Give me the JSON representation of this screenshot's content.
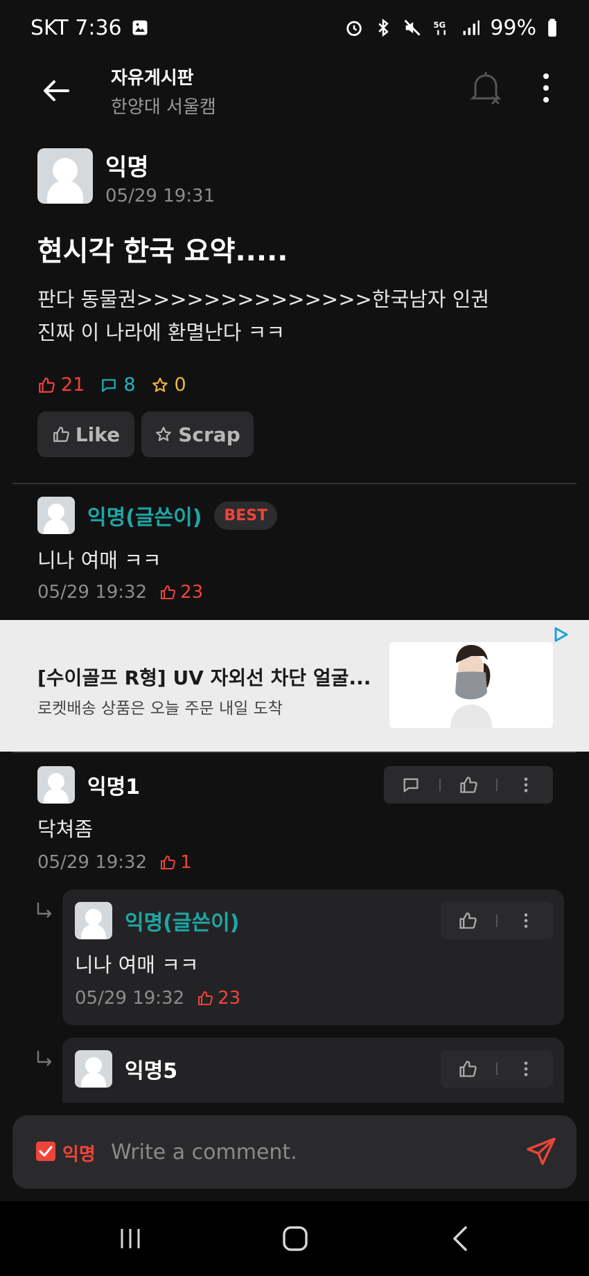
{
  "status_bar": {
    "carrier_time": "SKT 7:36",
    "battery": "99%"
  },
  "header": {
    "title": "자유게시판",
    "subtitle": "한양대 서울캠"
  },
  "post": {
    "author": "익명",
    "time": "05/29 19:31",
    "title": "현시각 한국 요약.....",
    "body_line1": "판다 동물권>>>>>>>>>>>>>>한국남자 인권",
    "body_line2": "진짜 이 나라에 환멸난다 ㅋㅋ",
    "likes": "21",
    "comments": "8",
    "scraps": "0",
    "like_label": "Like",
    "scrap_label": "Scrap"
  },
  "best_comment": {
    "author": "익명(글쓴이)",
    "badge": "BEST",
    "text": "니나 여매 ㅋㅋ",
    "time": "05/29 19:32",
    "likes": "23"
  },
  "ad": {
    "title": "[수이골프 R형] UV 자외선 차단 얼굴...",
    "subtitle": "로켓배송 상품은 오늘 주문 내일 도착"
  },
  "comments": [
    {
      "author": "익명1",
      "text": "닥쳐좀",
      "time": "05/29 19:32",
      "likes": "1"
    }
  ],
  "replies": [
    {
      "author": "익명(글쓴이)",
      "text": "니나 여매 ㅋㅋ",
      "time": "05/29 19:32",
      "likes": "23"
    },
    {
      "author": "익명5"
    }
  ],
  "comment_bar": {
    "anon_label": "익명",
    "placeholder": "Write a comment."
  },
  "colors": {
    "accent_red": "#f0443a",
    "teal": "#1fa7a5",
    "comment_cyan": "#1fb5c2",
    "scrap_yellow": "#f0b43a",
    "background": "#111112"
  }
}
